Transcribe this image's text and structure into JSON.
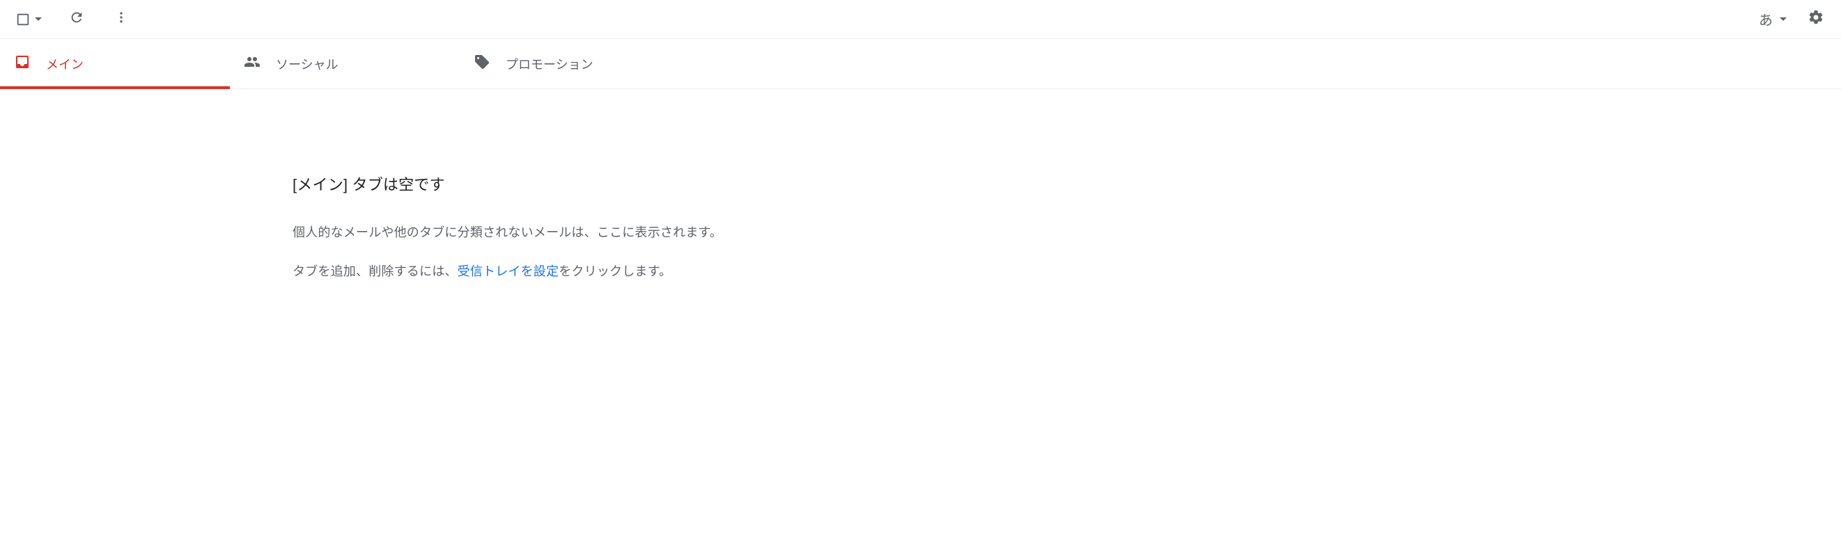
{
  "toolbar": {
    "language_label": "あ"
  },
  "tabs": {
    "primary": {
      "label": "メイン"
    },
    "social": {
      "label": "ソーシャル"
    },
    "promotions": {
      "label": "プロモーション"
    }
  },
  "empty": {
    "title": "[メイン] タブは空です",
    "line1": "個人的なメールや他のタブに分類されないメールは、ここに表示されます。",
    "line2_before": "タブを追加、削除するには、",
    "line2_link": "受信トレイを設定",
    "line2_after": "をクリックします。"
  }
}
